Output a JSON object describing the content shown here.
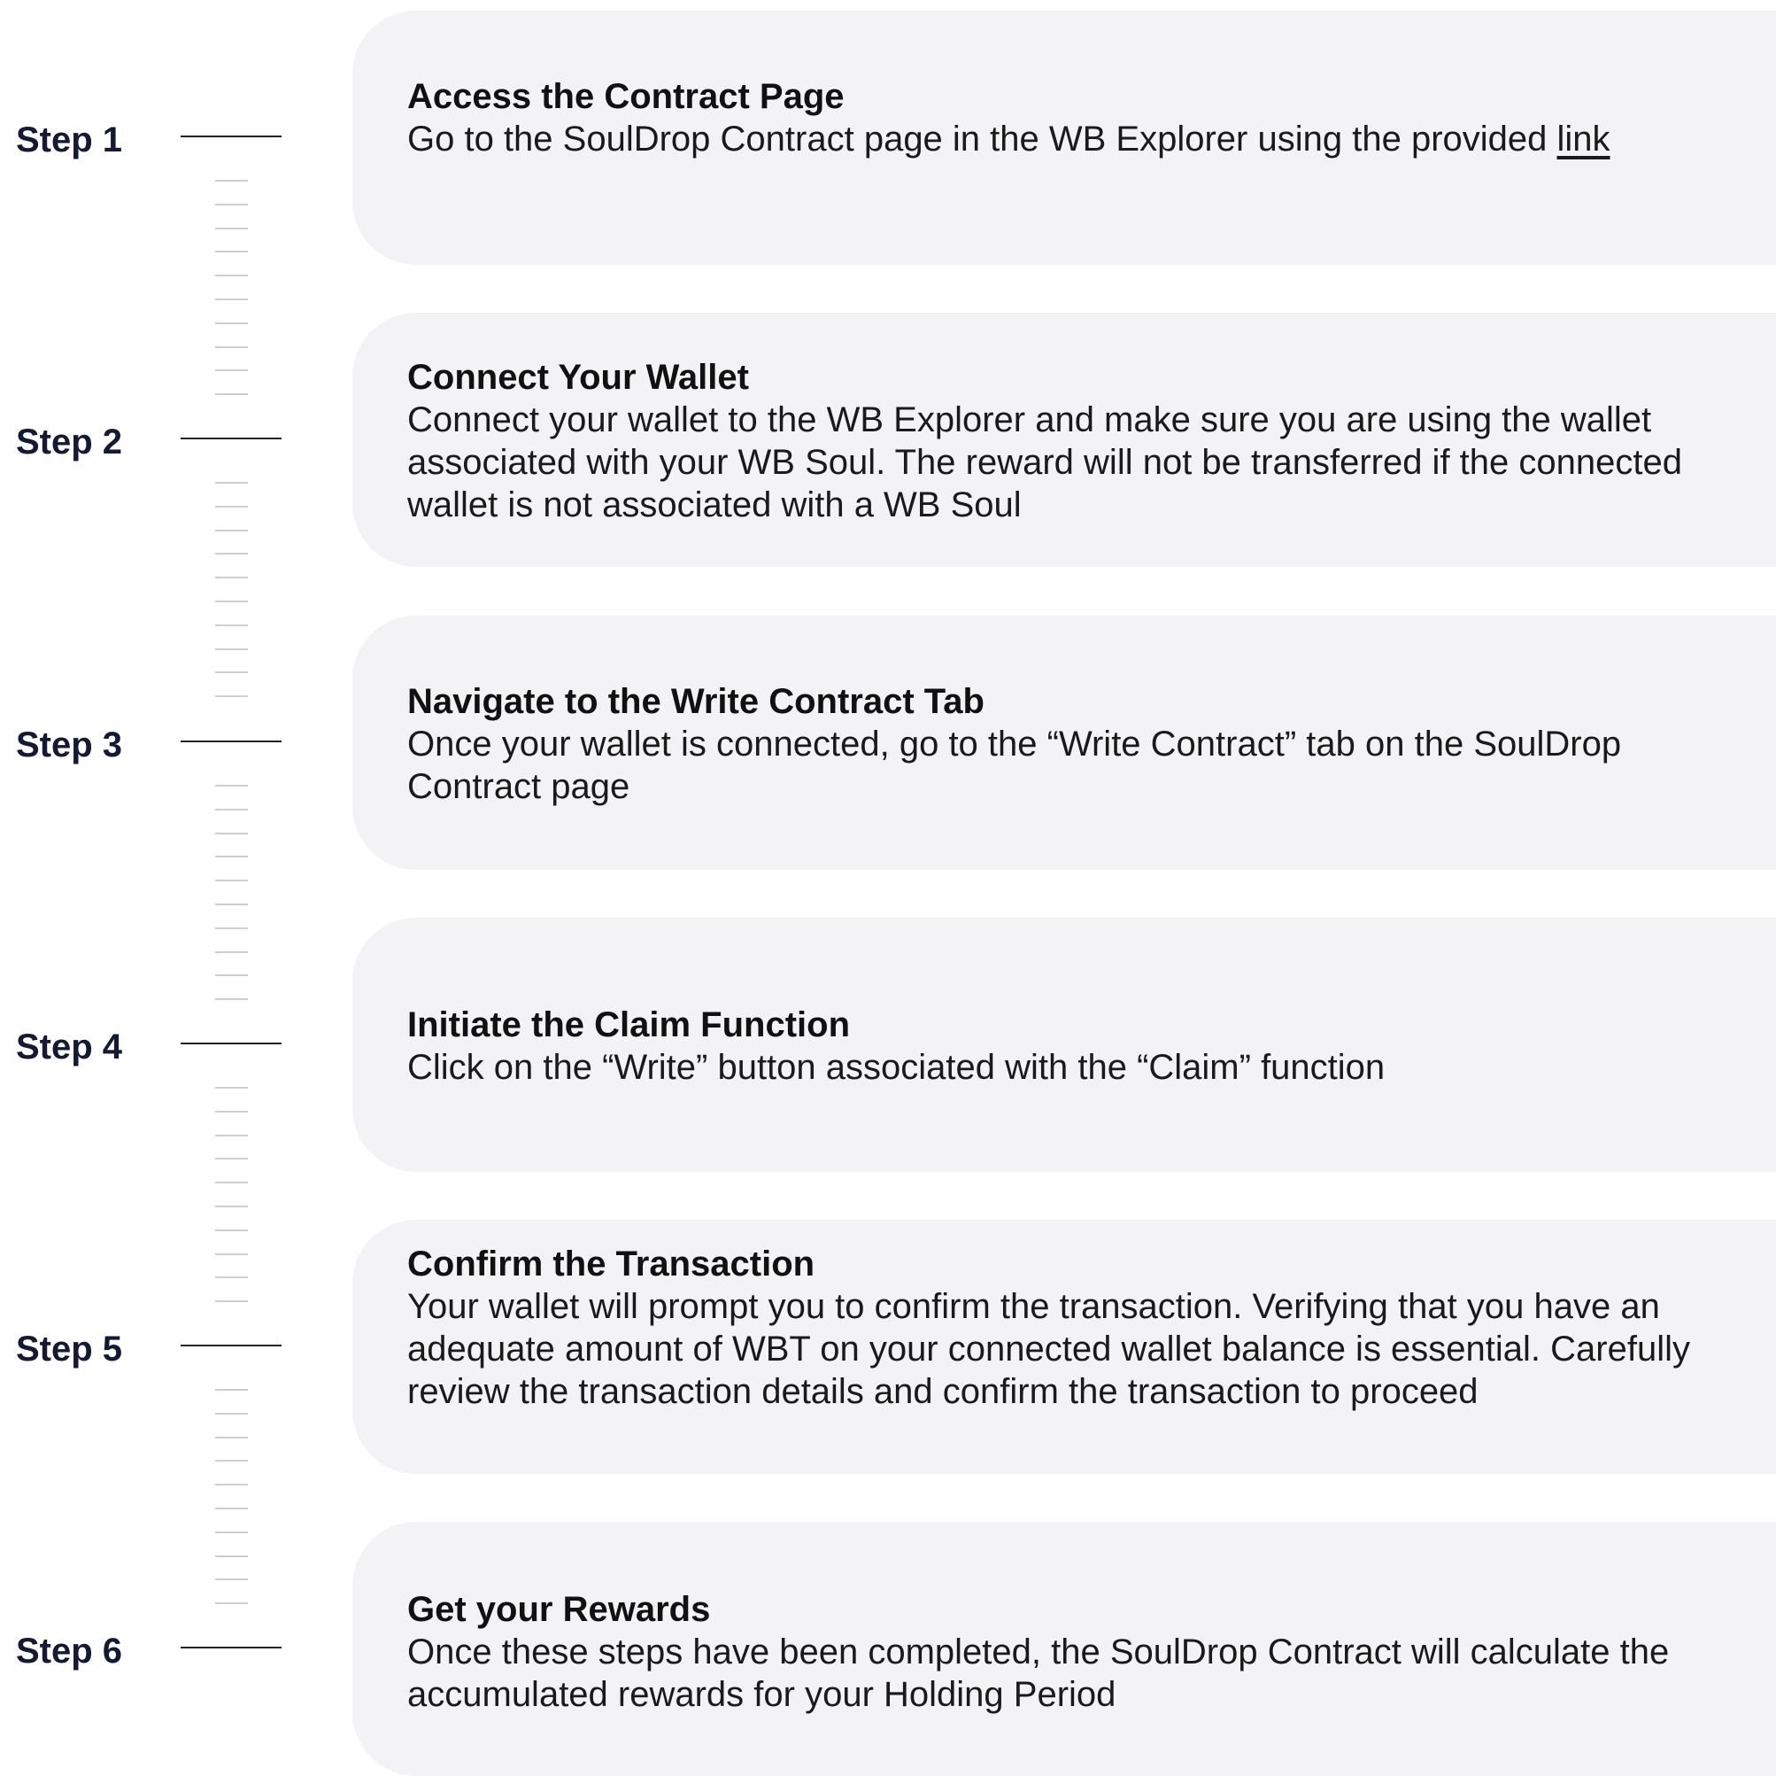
{
  "steps": [
    {
      "label": "Step 1",
      "title": "Access the Contract Page",
      "text_before_link": "Go to the SoulDrop Contract page in the WB Explorer using the provided ",
      "link_text": "link"
    },
    {
      "label": "Step 2",
      "title": "Connect Your Wallet",
      "text": "Connect your wallet to the WB Explorer and make sure you are using the wallet associated with your WB Soul. The reward will not be transferred if the connected wallet is not associated with a WB Soul"
    },
    {
      "label": "Step 3",
      "title": "Navigate to the Write Contract Tab",
      "text": "Once your wallet is connected, go to the “Write Contract” tab on the SoulDrop Contract page"
    },
    {
      "label": "Step 4",
      "title": "Initiate the Claim Function",
      "text": "Click on the “Write” button associated with the “Claim” function"
    },
    {
      "label": "Step 5",
      "title": "Confirm the Transaction",
      "text": "Your wallet will prompt you to confirm the transaction. Verifying that you have an adequate amount of WBT on your connected wallet balance is essential. Carefully review the transaction details and confirm the transaction to proceed"
    },
    {
      "label": "Step 6",
      "title": "Get your Rewards",
      "text": " Once these steps have been completed, the SoulDrop Contract will calculate the accumulated rewards for your Holding Period"
    }
  ]
}
